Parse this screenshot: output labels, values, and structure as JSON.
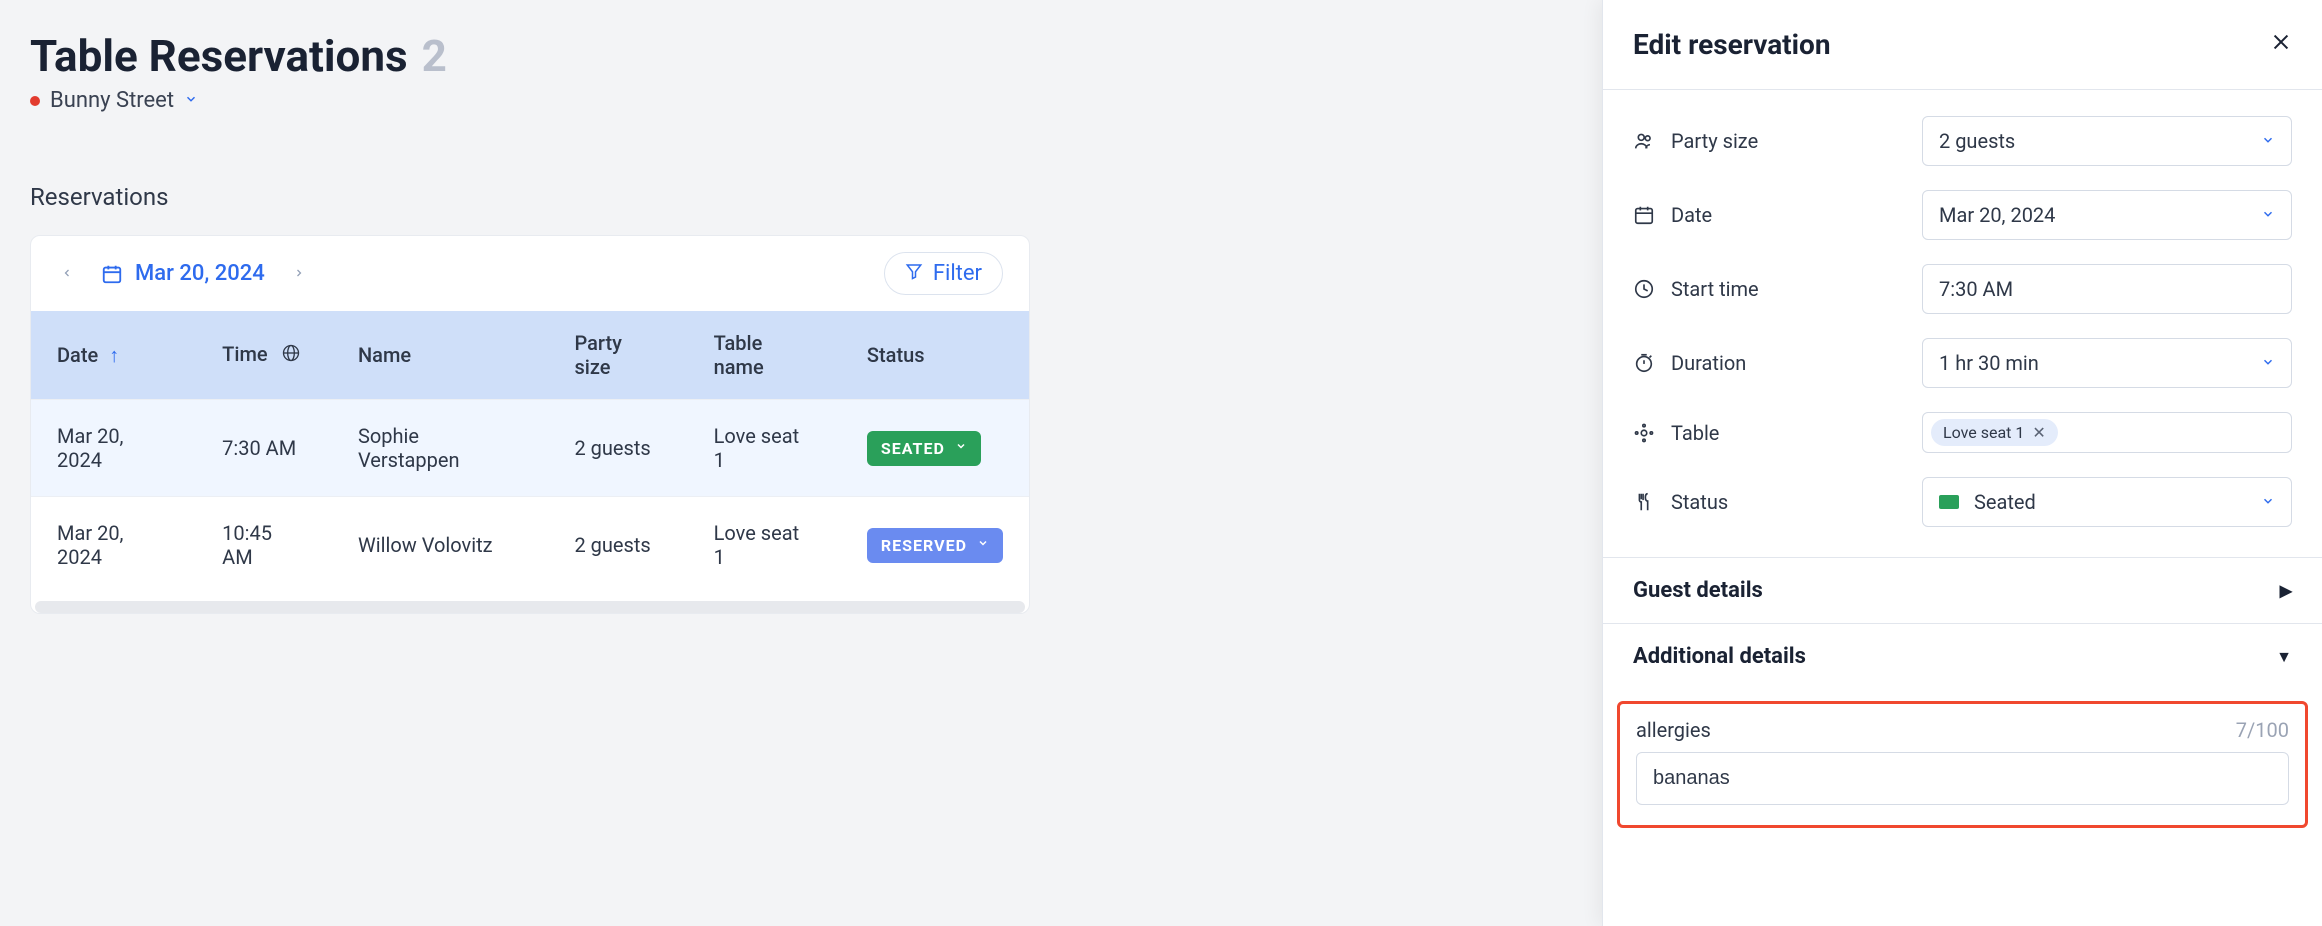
{
  "page": {
    "title": "Table Reservations",
    "count": "2",
    "location": "Bunny Street",
    "section_label": "Reservations"
  },
  "toolbar": {
    "date": "Mar 20, 2024",
    "filter_label": "Filter"
  },
  "table": {
    "headers": {
      "date": "Date",
      "time": "Time",
      "name": "Name",
      "party": "Party size",
      "table_name": "Table name",
      "status": "Status"
    },
    "rows": [
      {
        "date": "Mar 20, 2024",
        "time": "7:30 AM",
        "name": "Sophie Verstappen",
        "party": "2 guests",
        "table_name": "Love seat 1",
        "status_label": "SEATED",
        "status_kind": "seated",
        "selected": true
      },
      {
        "date": "Mar 20, 2024",
        "time": "10:45 AM",
        "name": "Willow Volovitz",
        "party": "2 guests",
        "table_name": "Love seat 1",
        "status_label": "RESERVED",
        "status_kind": "reserved",
        "selected": false
      }
    ]
  },
  "panel": {
    "title": "Edit reservation",
    "fields": {
      "party_size": {
        "label": "Party size",
        "value": "2 guests"
      },
      "date": {
        "label": "Date",
        "value": "Mar 20, 2024"
      },
      "start_time": {
        "label": "Start time",
        "value": "7:30 AM"
      },
      "duration": {
        "label": "Duration",
        "value": "1 hr 30 min"
      },
      "table": {
        "label": "Table",
        "chip": "Love seat 1"
      },
      "status": {
        "label": "Status",
        "value": "Seated"
      }
    },
    "guest_details_label": "Guest details",
    "additional_details_label": "Additional details",
    "additional": {
      "field_name": "allergies",
      "value": "bananas",
      "counter": "7/100"
    }
  }
}
